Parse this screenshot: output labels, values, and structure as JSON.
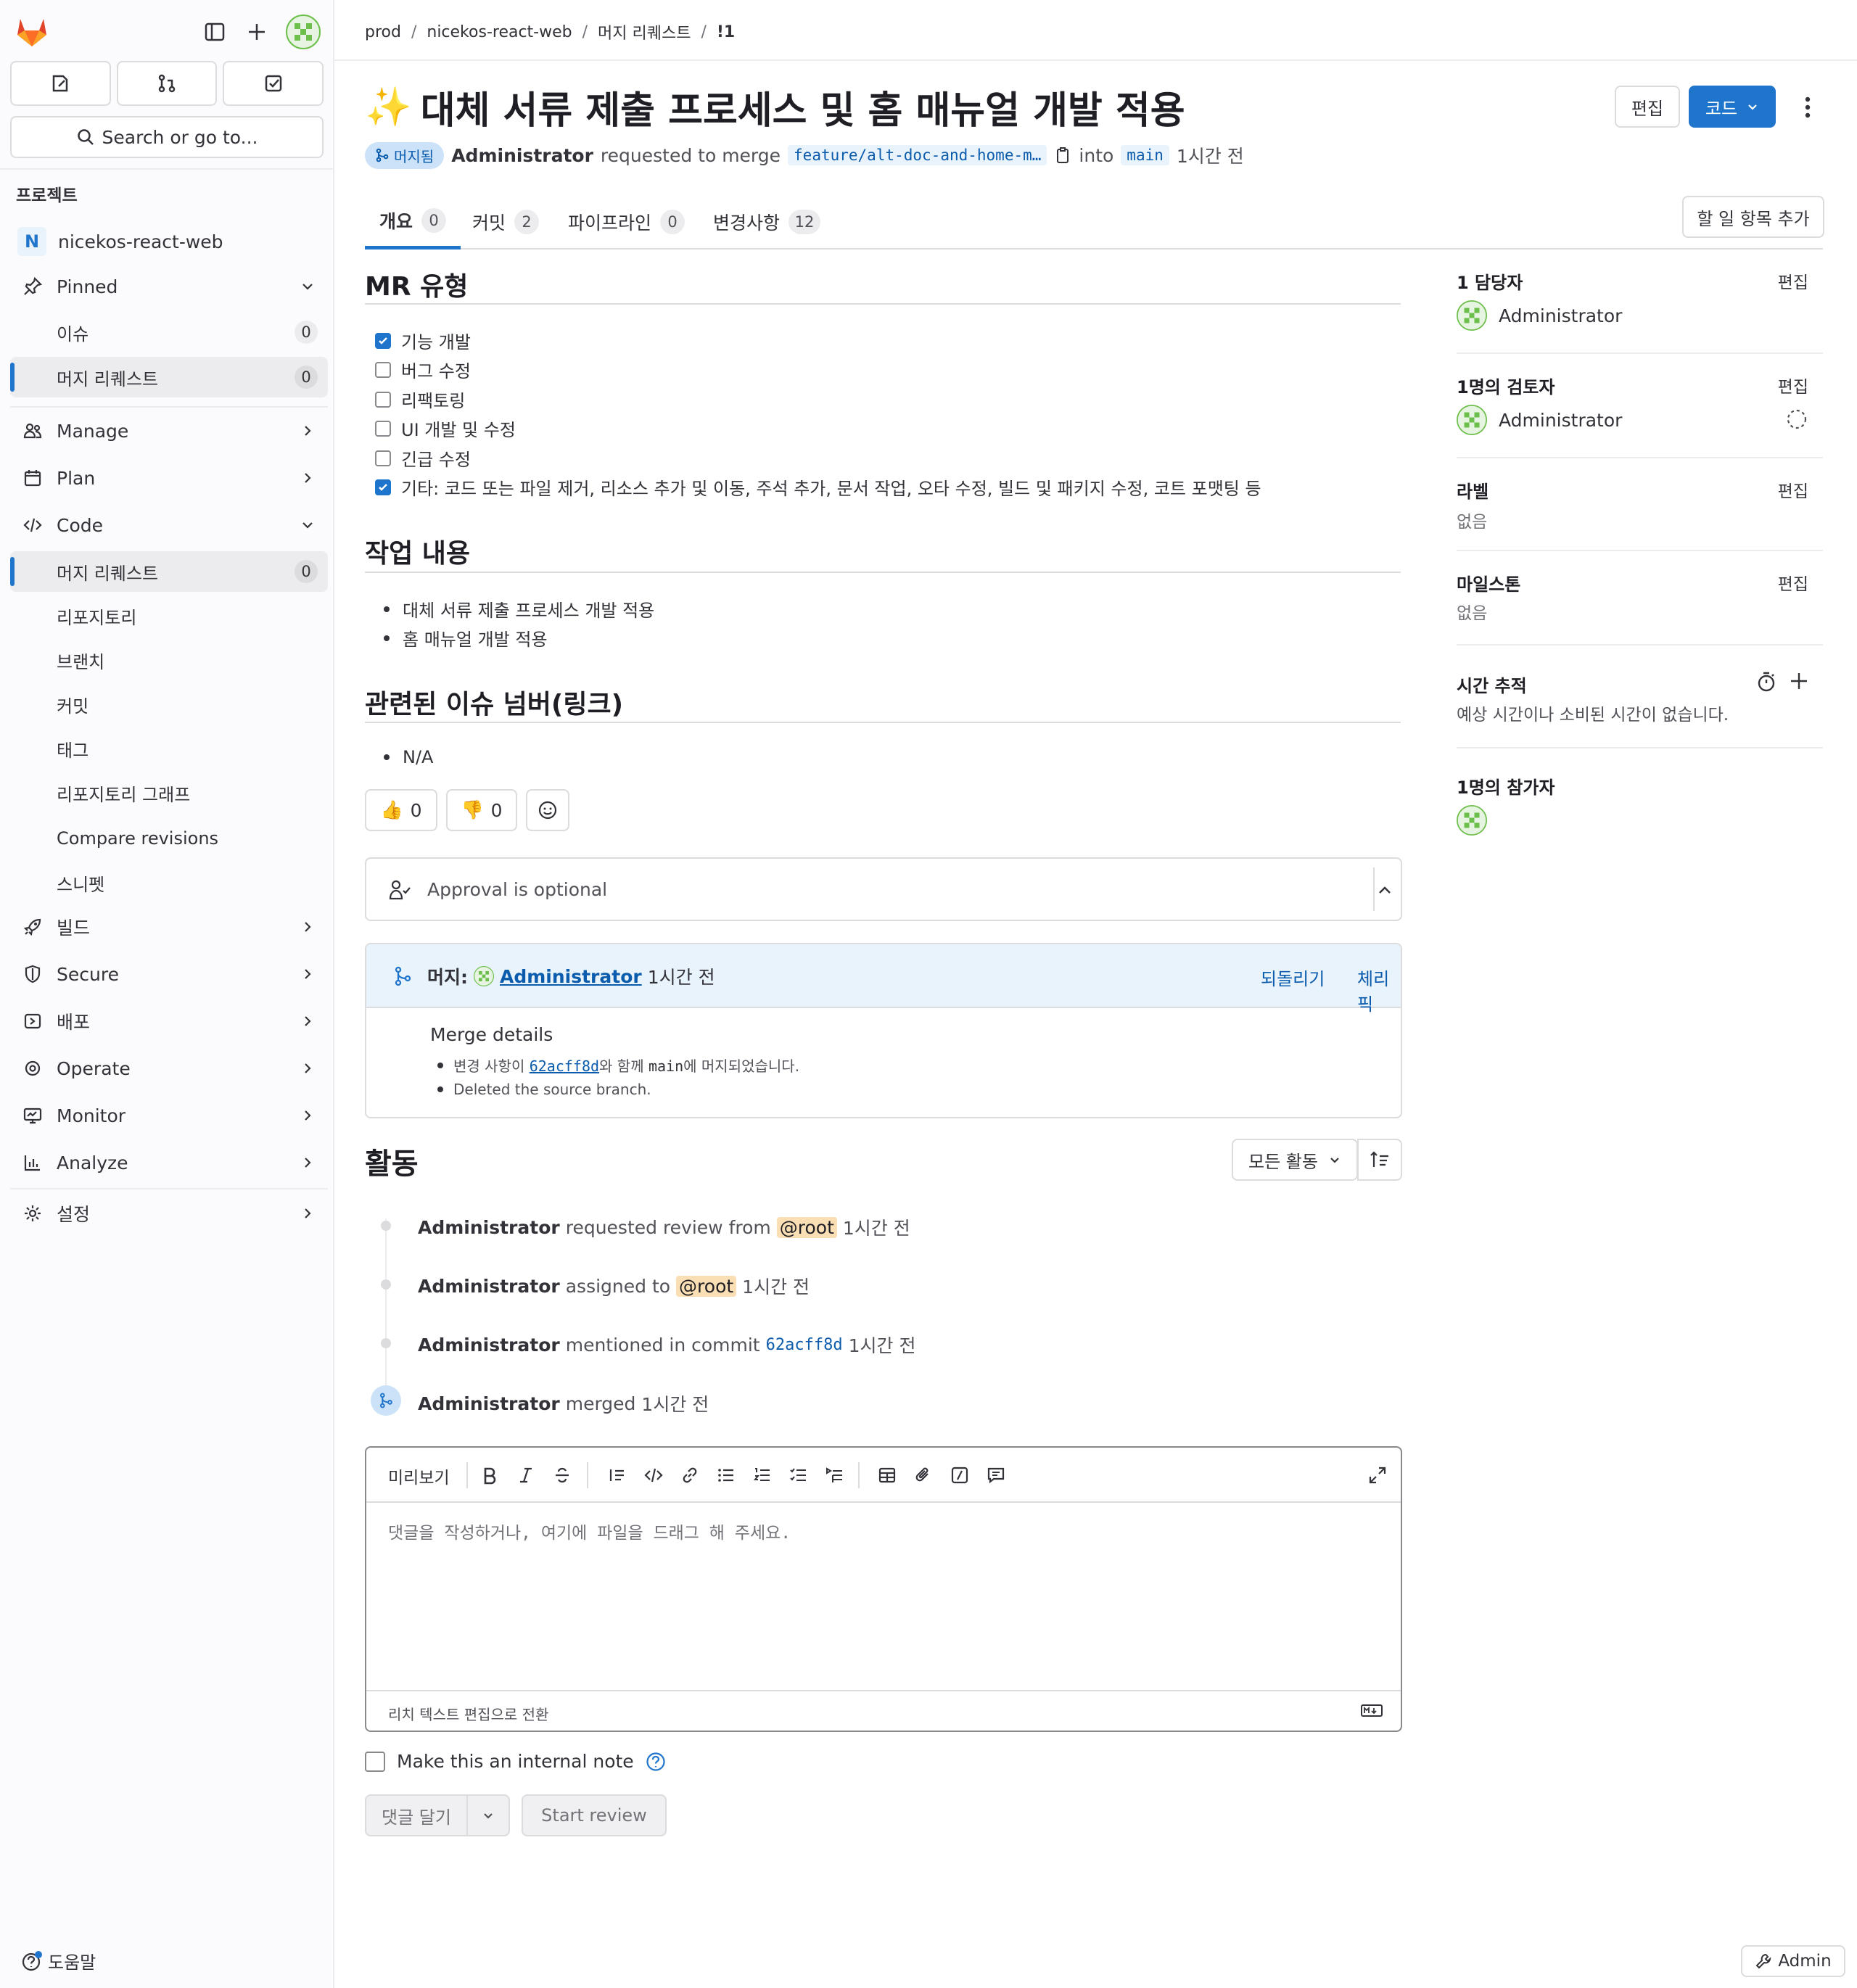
{
  "sidebar": {
    "search_label": "Search or go to...",
    "section_title": "프로젝트",
    "project_initial": "N",
    "project_name": "nicekos-react-web",
    "pinned": "Pinned",
    "pinned_items": [
      {
        "label": "이슈",
        "count": "0"
      },
      {
        "label": "머지 리퀘스트",
        "count": "0"
      }
    ],
    "manage": "Manage",
    "plan": "Plan",
    "code": "Code",
    "code_items": [
      {
        "label": "머지 리퀘스트",
        "count": "0"
      },
      {
        "label": "리포지토리"
      },
      {
        "label": "브랜치"
      },
      {
        "label": "커밋"
      },
      {
        "label": "태그"
      },
      {
        "label": "리포지토리 그래프"
      },
      {
        "label": "Compare revisions"
      },
      {
        "label": "스니펫"
      }
    ],
    "build": "빌드",
    "secure": "Secure",
    "deploy": "배포",
    "operate": "Operate",
    "monitor": "Monitor",
    "analyze": "Analyze",
    "settings": "설정",
    "help": "도움말"
  },
  "breadcrumb": [
    "prod",
    "nicekos-react-web",
    "머지 리퀘스트",
    "!1"
  ],
  "mr": {
    "title_emoji": "✨",
    "title": "대체 서류 제출 프로세스 및 홈 매뉴얼 개발 적용",
    "status": "머지됨",
    "author": "Administrator",
    "requested_text": "requested to merge",
    "source_branch": "feature/alt-doc-and-home-m…",
    "into_text": "into",
    "target_branch": "main",
    "time": "1시간 전",
    "edit_button": "편집",
    "code_button": "코드"
  },
  "tabs": [
    {
      "label": "개요",
      "count": "0"
    },
    {
      "label": "커밋",
      "count": "2"
    },
    {
      "label": "파이프라인",
      "count": "0"
    },
    {
      "label": "변경사항",
      "count": "12"
    }
  ],
  "todo_button": "할 일 항목 추가",
  "description": {
    "mr_type_heading": "MR 유형",
    "checkboxes": [
      {
        "label": "기능 개발",
        "checked": true
      },
      {
        "label": "버그 수정",
        "checked": false
      },
      {
        "label": "리팩토링",
        "checked": false
      },
      {
        "label": "UI 개발 및 수정",
        "checked": false
      },
      {
        "label": "긴급 수정",
        "checked": false
      },
      {
        "label": "기타: 코드 또는 파일 제거, 리소스 추가 및 이동, 주석 추가, 문서 작업, 오타 수정, 빌드 및 패키지 수정, 코트 포맷팅 등",
        "checked": true
      }
    ],
    "work_heading": "작업 내용",
    "work_items": [
      "대체 서류 제출 프로세스 개발 적용",
      "홈 매뉴얼 개발 적용"
    ],
    "issue_heading": "관련된 이슈 넘버(링크)",
    "issue_items": [
      "N/A"
    ]
  },
  "reactions": {
    "thumbs_up": "0",
    "thumbs_down": "0"
  },
  "approval": {
    "text": "Approval is optional"
  },
  "merge": {
    "label": "머지:",
    "user": "Administrator",
    "time": "1시간 전",
    "revert": "되돌리기",
    "cherry_pick": "체리픽",
    "details_title": "Merge details",
    "detail1_pre": "변경 사항이 ",
    "detail1_commit": "62acff8d",
    "detail1_mid": "와 함께 ",
    "detail1_branch": "main",
    "detail1_post": "에 머지되었습니다.",
    "detail2": "Deleted the source branch."
  },
  "activity": {
    "heading": "활동",
    "filter": "모든 활동",
    "items": [
      {
        "user": "Administrator",
        "text": "requested review from",
        "mention": "@root",
        "time": "1시간 전"
      },
      {
        "user": "Administrator",
        "text": "assigned to",
        "mention": "@root",
        "time": "1시간 전"
      },
      {
        "user": "Administrator",
        "text": "mentioned in commit",
        "commit": "62acff8d",
        "time": "1시간 전"
      },
      {
        "user": "Administrator",
        "text": "merged",
        "time": "1시간 전"
      }
    ]
  },
  "editor": {
    "preview": "미리보기",
    "placeholder": "댓글을 작성하거나, 여기에 파일을 드래그 해 주세요.",
    "switch_rich": "리치 텍스트 편집으로 전환",
    "internal_note": "Make this an internal note",
    "comment_button": "댓글 달기",
    "start_review": "Start review"
  },
  "right": {
    "assignee_label": "1 담당자",
    "assignee": "Administrator",
    "reviewer_label": "1명의 검토자",
    "reviewer": "Administrator",
    "labels_label": "라벨",
    "labels_value": "없음",
    "milestone_label": "마일스톤",
    "milestone_value": "없음",
    "time_label": "시간 추적",
    "time_value": "예상 시간이나 소비된 시간이 없습니다.",
    "participants_label": "1명의 참가자",
    "edit": "편집"
  },
  "admin_button": "Admin",
  "colors": {
    "accent": "#1f75cb",
    "merged_bg": "#cbe2f9",
    "mention_bg": "#fbdfb4",
    "orange": "#e24329"
  }
}
